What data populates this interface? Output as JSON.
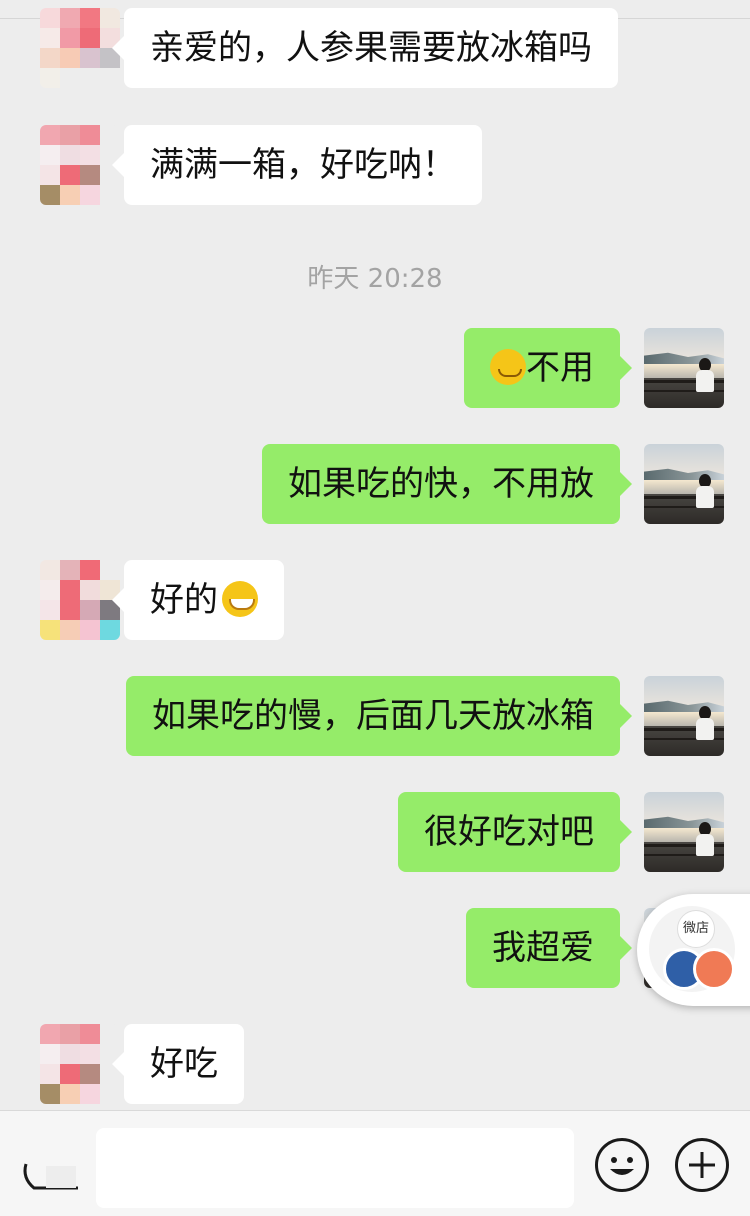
{
  "messages": [
    {
      "side": "left",
      "text": "亲爱的，人参果需要放冰箱吗"
    },
    {
      "side": "left",
      "text": "满满一箱，好吃呐！"
    },
    {
      "side": "right",
      "text": "不用",
      "emoji": "thinking-face-emoji"
    },
    {
      "side": "right",
      "text": "如果吃的快，不用放"
    },
    {
      "side": "left",
      "text": "好的",
      "emoji": "grinning-face-emoji"
    },
    {
      "side": "right",
      "text": "如果吃的慢，后面几天放冰箱"
    },
    {
      "side": "right",
      "text": "很好吃对吧"
    },
    {
      "side": "right",
      "text": "我超爱"
    },
    {
      "side": "left",
      "text": "好吃"
    }
  ],
  "timestamp": "昨天 20:28",
  "floating_panel": {
    "badge_label": "微店"
  },
  "input": {
    "placeholder": ""
  },
  "colors": {
    "background": "#ededed",
    "bubble_sent": "#95ec69",
    "bubble_received": "#ffffff"
  }
}
